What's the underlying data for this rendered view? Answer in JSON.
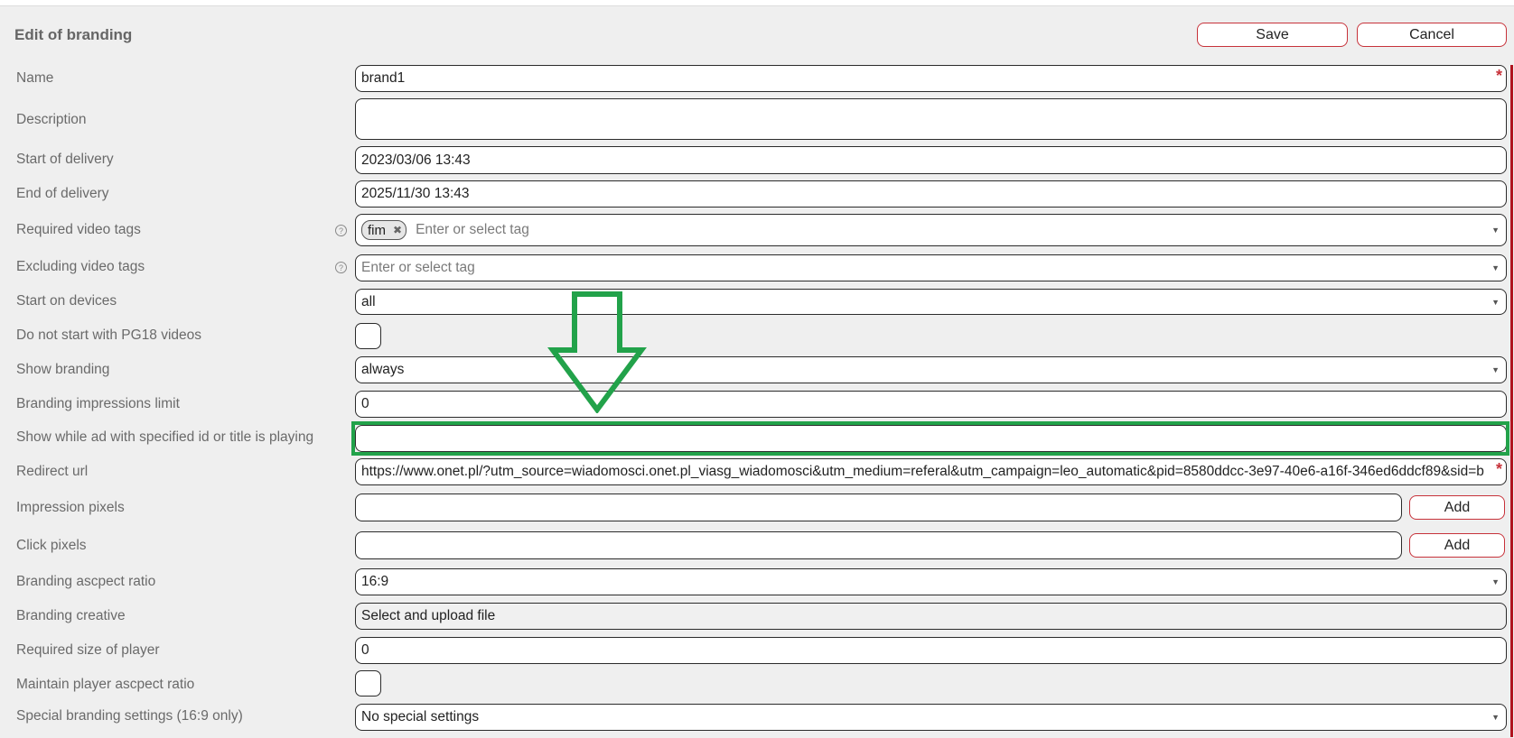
{
  "header": {
    "title": "Edit of branding",
    "save_label": "Save",
    "cancel_label": "Cancel"
  },
  "form": {
    "name": {
      "label": "Name",
      "value": "brand1",
      "required_mark": "*"
    },
    "description": {
      "label": "Description",
      "value": ""
    },
    "start_delivery": {
      "label": "Start of delivery",
      "value": "2023/03/06 13:43"
    },
    "end_delivery": {
      "label": "End of delivery",
      "value": "2025/11/30 13:43"
    },
    "required_tags": {
      "label": "Required video tags",
      "tags": [
        "fim"
      ],
      "placeholder": "Enter or select tag",
      "help": "?"
    },
    "excluding_tags": {
      "label": "Excluding video tags",
      "placeholder": "Enter or select tag",
      "help": "?"
    },
    "start_devices": {
      "label": "Start on devices",
      "value": "all"
    },
    "no_pg18": {
      "label": "Do not start with PG18 videos",
      "checked": false
    },
    "show_branding": {
      "label": "Show branding",
      "value": "always"
    },
    "impressions_limit": {
      "label": "Branding impressions limit",
      "value": "0"
    },
    "show_while_ad": {
      "label": "Show while ad with specified id or title is playing",
      "value": ""
    },
    "redirect_url": {
      "label": "Redirect url",
      "value": "https://www.onet.pl/?utm_source=wiadomosci.onet.pl_viasg_wiadomosci&utm_medium=referal&utm_campaign=leo_automatic&pid=8580ddcc-3e97-40e6-a16f-346ed6ddcf89&sid=b",
      "required_mark": "*"
    },
    "impression_pixels": {
      "label": "Impression pixels",
      "value": "",
      "add_label": "Add"
    },
    "click_pixels": {
      "label": "Click pixels",
      "value": "",
      "add_label": "Add"
    },
    "aspect_ratio": {
      "label": "Branding ascpect ratio",
      "value": "16:9"
    },
    "creative": {
      "label": "Branding creative",
      "value": "Select and upload file"
    },
    "player_size": {
      "label": "Required size of player",
      "value": "0"
    },
    "maintain_ratio": {
      "label": "Maintain player ascpect ratio",
      "checked": false
    },
    "special_settings": {
      "label": "Special branding settings (16:9 only)",
      "value": "No special settings"
    }
  },
  "icons": {
    "dropdown": "chevron-down-icon",
    "tag_remove": "close-icon",
    "help": "help-circle-icon"
  },
  "colors": {
    "accent": "#c7323a",
    "highlight": "#22a24a",
    "panel": "#efefef"
  }
}
